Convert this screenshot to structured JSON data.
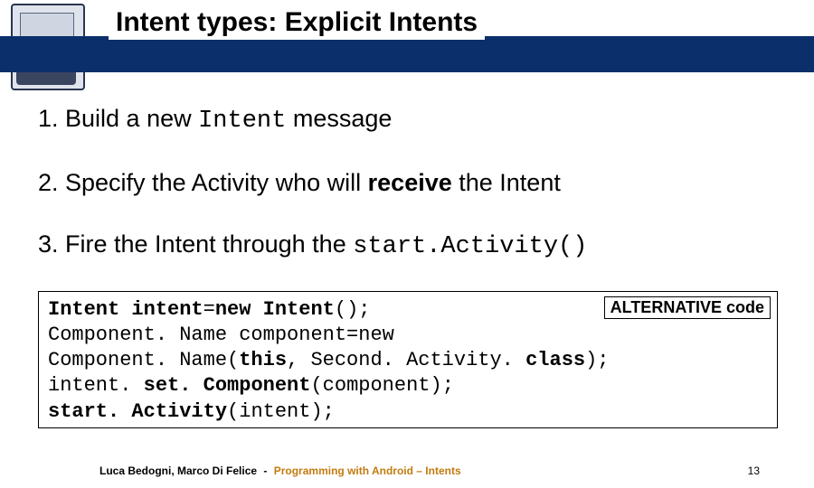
{
  "header": {
    "title_plain_pre": "Intent ",
    "title_emph": "types:",
    "title_plain_post": " Explicit Intents"
  },
  "steps": {
    "s1_pre": "1.  Build a new ",
    "s1_mono": "Intent",
    "s1_post": " message",
    "s2_pre": "2. Specify the Activity who will ",
    "s2_bold": "receive",
    "s2_post": " the Intent",
    "s3_pre": "3. Fire the Intent through the ",
    "s3_mono": "start.Activity()"
  },
  "codebox": {
    "l1a": "Intent intent",
    "l1b": "=",
    "l1c": "new Intent",
    "l1d": "();",
    "l2": "Component. Name component=new",
    "l3a": "Component. Name(",
    "l3b": "this",
    "l3c": ", Second. Activity. ",
    "l3d": "class",
    "l3e": ");",
    "l4a": "intent. ",
    "l4b": "set. Component",
    "l4c": "(component);",
    "l5a": "start. Activity",
    "l5b": "(intent);"
  },
  "alt_label": "ALTERNATIVE code",
  "footer": {
    "authors": "Luca Bedogni, Marco Di Felice",
    "dash": " - ",
    "topic": "Programming with Android – Intents",
    "page": "13"
  }
}
